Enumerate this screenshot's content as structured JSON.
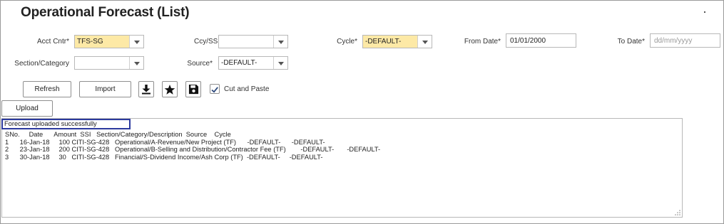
{
  "page": {
    "title": "Operational Forecast (List)"
  },
  "filters": {
    "acct_cntr": {
      "label": "Acct Cntr*",
      "value": "TFS-SG"
    },
    "ccy_ssi": {
      "label": "Ccy/SSI*",
      "value": ""
    },
    "cycle": {
      "label": "Cycle*",
      "value": "-DEFAULT-"
    },
    "from_date": {
      "label": "From Date*",
      "value": "01/01/2000"
    },
    "to_date": {
      "label": "To Date*",
      "value": "",
      "placeholder": "dd/mm/yyyy"
    },
    "section_category": {
      "label": "Section/Category",
      "value": ""
    },
    "source": {
      "label": "Source*",
      "value": "-DEFAULT-"
    }
  },
  "toolbar": {
    "refresh_label": "Refresh",
    "import_label": "Import",
    "download_icon": "download-icon",
    "favorite_icon": "star-icon",
    "save_icon": "save-icon",
    "cut_paste": {
      "label": "Cut and Paste",
      "checked": true
    },
    "upload_label": "Upload"
  },
  "paste_area": {
    "message": "Forecast uploaded successfully",
    "header_line": "SNo.     Date      Amount  SSI   Section/Category/Description  Source    Cycle",
    "rows": [
      "1      16-Jan-18     100 CITI-SG-428   Operational/A-Revenue/New Project (TF)      -DEFAULT-      -DEFAULT-",
      "2      23-Jan-18     200 CITI-SG-428   Operational/B-Selling and Distribution/Contractor Fee (TF)        -DEFAULT-       -DEFAULT-",
      "3      30-Jan-18     30   CITI-SG-428   Financial/S-Dividend Income/Ash Corp (TF)  -DEFAULT-     -DEFAULT-"
    ]
  },
  "colors": {
    "required_highlight": "#fde9a6",
    "message_border": "#2c3a9e"
  }
}
